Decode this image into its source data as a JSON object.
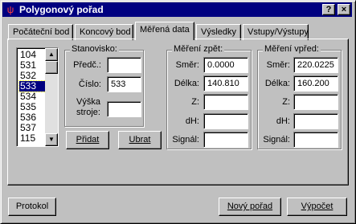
{
  "window": {
    "title": "Polygonový pořad",
    "icon": "polygon-app-icon",
    "help_label": "?",
    "close_label": "×"
  },
  "tabs": [
    {
      "label": "Počáteční bod",
      "active": false
    },
    {
      "label": "Koncový bod",
      "active": false
    },
    {
      "label": "Měřená data",
      "active": true
    },
    {
      "label": "Výsledky",
      "active": false
    },
    {
      "label": "Vstupy/Výstupy",
      "active": false
    }
  ],
  "point_list": {
    "items": [
      "104",
      "531",
      "532",
      "533",
      "534",
      "535",
      "536",
      "537",
      "115"
    ],
    "selected": "533"
  },
  "stanovisko": {
    "title": "Stanovisko:",
    "predc_label": "Předč.:",
    "predc_value": "",
    "cislo_label": "Číslo:",
    "cislo_value": "533",
    "vyska_label_1": "Výška",
    "vyska_label_2": "stroje:",
    "vyska_value": ""
  },
  "buttons": {
    "add_label": "Přidat",
    "remove_label": "Ubrat",
    "protocol_label": "Protokol",
    "new_label": "Nový pořad",
    "compute_label": "Výpočet"
  },
  "mereni_zpet": {
    "title": "Měření zpět:",
    "smer_label": "Směr:",
    "smer_value": "0.0000",
    "delka_label": "Délka:",
    "delka_value": "140.810",
    "z_label": "Z:",
    "z_value": "",
    "dh_label": "dH:",
    "dh_value": "",
    "signal_label": "Signál:",
    "signal_value": ""
  },
  "mereni_vpred": {
    "title": "Měření vpřed:",
    "smer_label": "Směr:",
    "smer_value": "220.0225",
    "delka_label": "Délka:",
    "delka_value": "160.200",
    "z_label": "Z:",
    "z_value": "",
    "dh_label": "dH:",
    "dh_value": "",
    "signal_label": "Signál:",
    "signal_value": ""
  }
}
